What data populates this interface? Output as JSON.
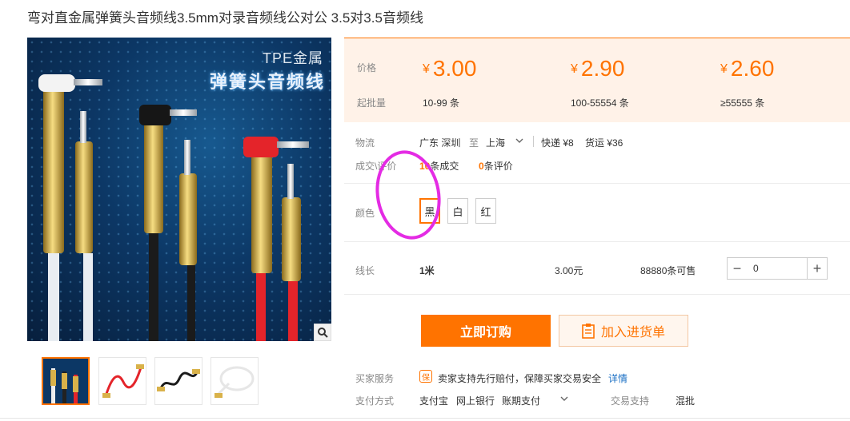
{
  "page": {
    "title": "弯对直金属弹簧头音频线3.5mm对录音频线公对公 3.5对3.5音频线"
  },
  "gallery": {
    "brand_text": "TPE金属",
    "slogan_text": "弹簧头音频线",
    "zoom_icon": "magnifier-icon",
    "thumbnails": [
      {
        "icon": "cable-straight-product-thumb",
        "active": true
      },
      {
        "icon": "coiled-red-cable-thumb",
        "active": false
      },
      {
        "icon": "coiled-black-cable-thumb",
        "active": false
      },
      {
        "icon": "white-cable-thumb",
        "active": false
      }
    ]
  },
  "pricing": {
    "price_label": "价格",
    "moq_label": "起批量",
    "currency": "¥",
    "tiers": [
      {
        "price": "3.00",
        "range": "10-99 条"
      },
      {
        "price": "2.90",
        "range": "100-55554 条"
      },
      {
        "price": "2.60",
        "range": "≥55555 条"
      }
    ]
  },
  "logistics": {
    "label": "物流",
    "origin": "广东 深圳",
    "to": "至",
    "destination": "上海",
    "express": "快递 ¥8",
    "freight": "货运 ¥36"
  },
  "stats": {
    "label": "成交\\评价",
    "deals_count": "10",
    "deals_text": "条成交",
    "reviews_count": "0",
    "reviews_text": "条评价"
  },
  "color_option": {
    "label": "颜色",
    "options": [
      "黑",
      "白",
      "红"
    ],
    "selected": "黑"
  },
  "length_option": {
    "label": "线长",
    "value": "1米",
    "price": "3.00元",
    "stock": "88880条可售",
    "quantity": "0"
  },
  "actions": {
    "order_label": "立即订购",
    "cart_label": "加入进货单"
  },
  "services": {
    "label": "买家服务",
    "badge": "保",
    "text": "卖家支持先行赔付，保障买家交易安全",
    "detail_link": "详情"
  },
  "payment": {
    "label": "支付方式",
    "methods": [
      "支付宝",
      "网上银行",
      "账期支付"
    ],
    "trade_label": "交易支持",
    "trade_value": "混批"
  },
  "colors": {
    "accent": "#ff7300",
    "price_bg": "#fff2e8",
    "annotation": "#e42be4"
  }
}
